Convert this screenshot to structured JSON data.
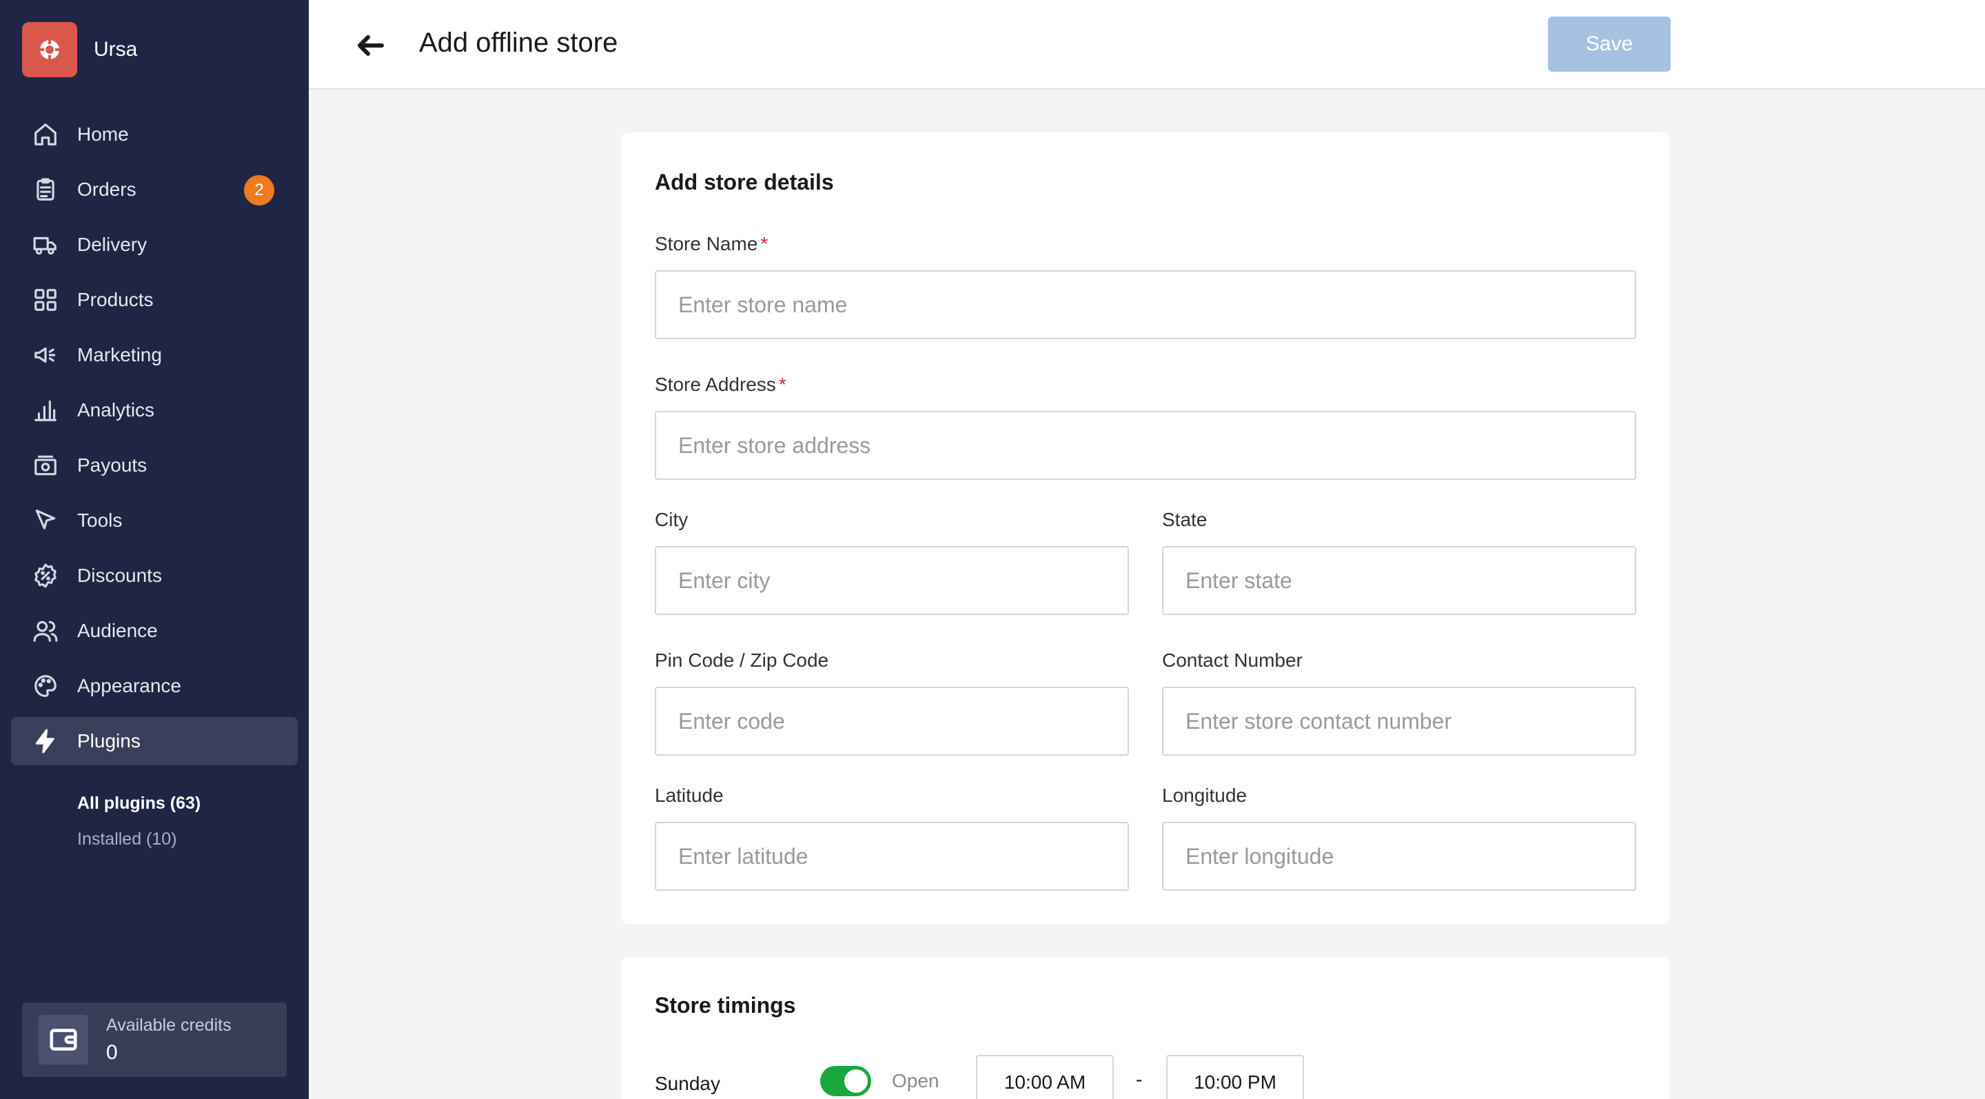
{
  "brand": {
    "name": "Ursa",
    "logo_color": "#d9574b"
  },
  "sidebar": {
    "items": [
      {
        "label": "Home",
        "icon": "home-icon"
      },
      {
        "label": "Orders",
        "icon": "clipboard-icon",
        "badge": "2"
      },
      {
        "label": "Delivery",
        "icon": "truck-icon"
      },
      {
        "label": "Products",
        "icon": "grid-icon"
      },
      {
        "label": "Marketing",
        "icon": "megaphone-icon"
      },
      {
        "label": "Analytics",
        "icon": "bar-chart-icon"
      },
      {
        "label": "Payouts",
        "icon": "cash-icon"
      },
      {
        "label": "Tools",
        "icon": "cursor-icon"
      },
      {
        "label": "Discounts",
        "icon": "discount-icon"
      },
      {
        "label": "Audience",
        "icon": "users-icon"
      },
      {
        "label": "Appearance",
        "icon": "palette-icon"
      },
      {
        "label": "Plugins",
        "icon": "lightning-icon",
        "active": true
      }
    ],
    "subitems": [
      {
        "label": "All plugins (63)"
      },
      {
        "label": "Installed (10)"
      }
    ],
    "credits": {
      "label": "Available credits",
      "value": "0"
    }
  },
  "header": {
    "title": "Add offline store",
    "save_label": "Save"
  },
  "store_details": {
    "title": "Add store details",
    "store_name": {
      "label": "Store Name",
      "required": "*",
      "placeholder": "Enter store name",
      "value": ""
    },
    "store_address": {
      "label": "Store Address",
      "required": "*",
      "placeholder": "Enter store address",
      "value": ""
    },
    "city": {
      "label": "City",
      "placeholder": "Enter city"
    },
    "state": {
      "label": "State",
      "placeholder": "Enter state"
    },
    "pin_code": {
      "label": "Pin Code / Zip Code",
      "placeholder": "Enter code"
    },
    "contact": {
      "label": "Contact Number",
      "placeholder": "Enter store contact number"
    },
    "latitude": {
      "label": "Latitude",
      "placeholder": "Enter latitude"
    },
    "longitude": {
      "label": "Longitude",
      "placeholder": "Enter longitude"
    }
  },
  "timings": {
    "title": "Store timings",
    "rows": [
      {
        "day": "Sunday",
        "status": "Open",
        "open": "10:00 AM",
        "separator": "-",
        "close": "10:00 PM",
        "enabled": true
      }
    ]
  },
  "colors": {
    "sidebar_bg": "#1f2643",
    "accent_save": "#a7c1e3",
    "badge": "#f07a1f",
    "toggle_on": "#1aa73b"
  }
}
